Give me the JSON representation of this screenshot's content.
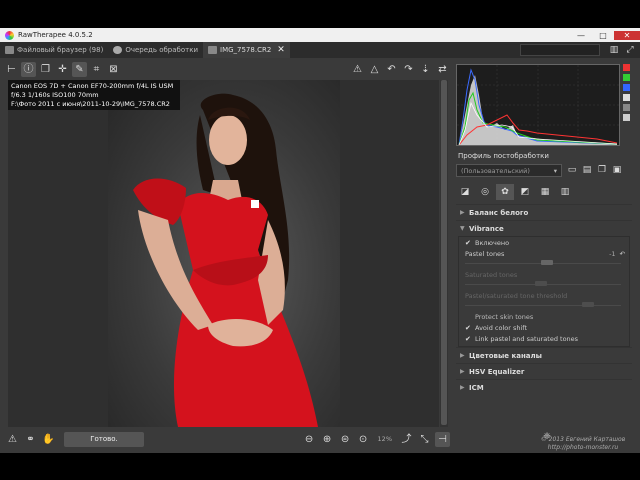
{
  "window": {
    "title": "RawTherapee 4.0.5.2",
    "controls": [
      "—",
      "□",
      "✕"
    ]
  },
  "tabs": [
    {
      "label": "Файловый браузер (98)"
    },
    {
      "label": "Очередь обработки"
    },
    {
      "label": "IMG_7578.CR2",
      "close": "✕"
    }
  ],
  "exif": {
    "line1": "Canon EOS 7D + Canon EF70-200mm f/4L IS USM",
    "line2": "f/6.3  1/160s  ISO100  70mm",
    "line3": "F:\\Фото 2011 с июня\\2011-10-29\\IMG_7578.CR2"
  },
  "toolbar": {
    "left_icons": [
      "toolbar-arrow-icon",
      "info-icon",
      "before-after-icon",
      "crosshair-icon",
      "color-picker-icon",
      "crop-icon",
      "straighten-icon"
    ],
    "right_icons": [
      "clip-highlight-icon",
      "clip-shadow-icon",
      "rotate-left-icon",
      "rotate-right-icon",
      "flip-vertical-icon",
      "flip-horizontal-icon"
    ]
  },
  "status": {
    "text": "Готово.",
    "zoom": "12%"
  },
  "panel": {
    "profile_label": "Профиль постобработки",
    "profile_value": "(Пользовательский)",
    "sections": {
      "white_balance": "Баланс белого",
      "vibrance": "Vibrance",
      "channel_mixer": "Цветовые каналы",
      "hsv": "HSV Equalizer",
      "icm": "ICM"
    },
    "vibrance": {
      "enabled": "Включено",
      "pastel_label": "Pastel tones",
      "pastel_value": "-1",
      "pastel_fraction": 0.49,
      "saturated_label": "Saturated tones",
      "link_label": "Pastel/saturated tone threshold",
      "protect_skin": "Protect skin tones",
      "avoid_shift": "Avoid color shift",
      "link_tones": "Link pastel and saturated tones"
    }
  },
  "watermark": {
    "line1": "© 2013 Евгений Карташов",
    "line2": "http://photo-monster.ru"
  },
  "colors": {
    "accent": "#cc2222",
    "background": "#3a3a3a",
    "histogram_bg": "#1d1d1d"
  }
}
